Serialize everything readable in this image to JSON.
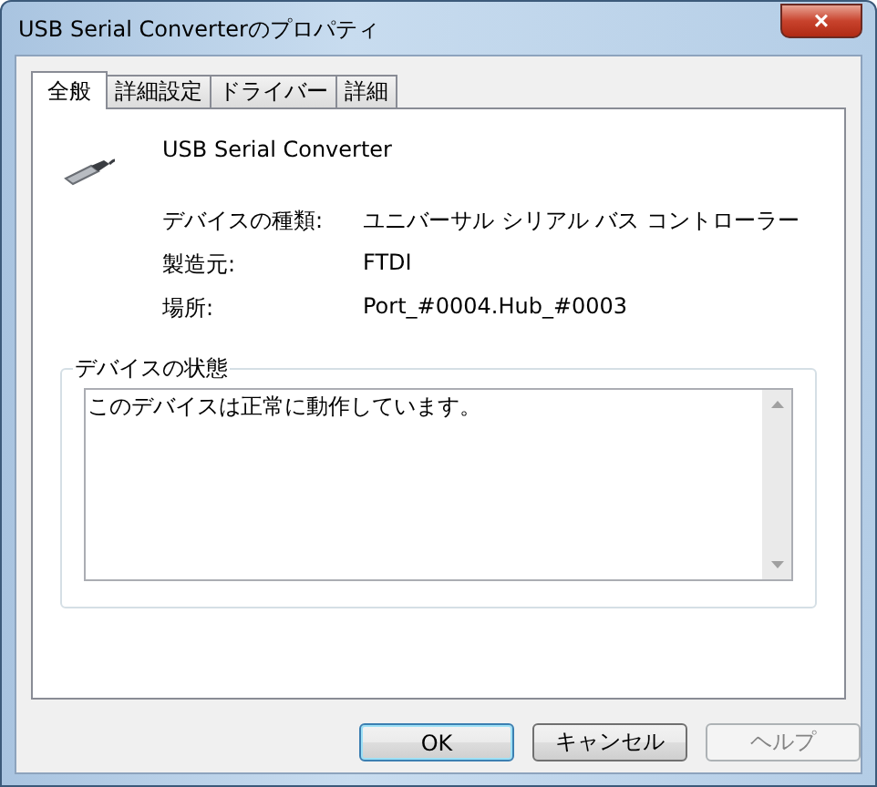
{
  "window": {
    "title": "USB Serial Converterのプロパティ",
    "close": "×"
  },
  "tabs": [
    {
      "label": "全般",
      "selected": true
    },
    {
      "label": "詳細設定",
      "selected": false
    },
    {
      "label": "ドライバー",
      "selected": false
    },
    {
      "label": "詳細",
      "selected": false
    }
  ],
  "device": {
    "name": "USB Serial Converter"
  },
  "properties": [
    {
      "label": "デバイスの種類:",
      "value": "ユニバーサル シリアル バス コントローラー"
    },
    {
      "label": "製造元:",
      "value": "FTDI"
    },
    {
      "label": "場所:",
      "value": "Port_#0004.Hub_#0003"
    }
  ],
  "status_group": {
    "title": "デバイスの状態",
    "text": "このデバイスは正常に動作しています。"
  },
  "buttons": [
    {
      "label": "OK",
      "default": true,
      "disabled": false
    },
    {
      "label": "キャンセル",
      "default": false,
      "disabled": false
    },
    {
      "label": "ヘルプ",
      "default": false,
      "disabled": true
    }
  ]
}
